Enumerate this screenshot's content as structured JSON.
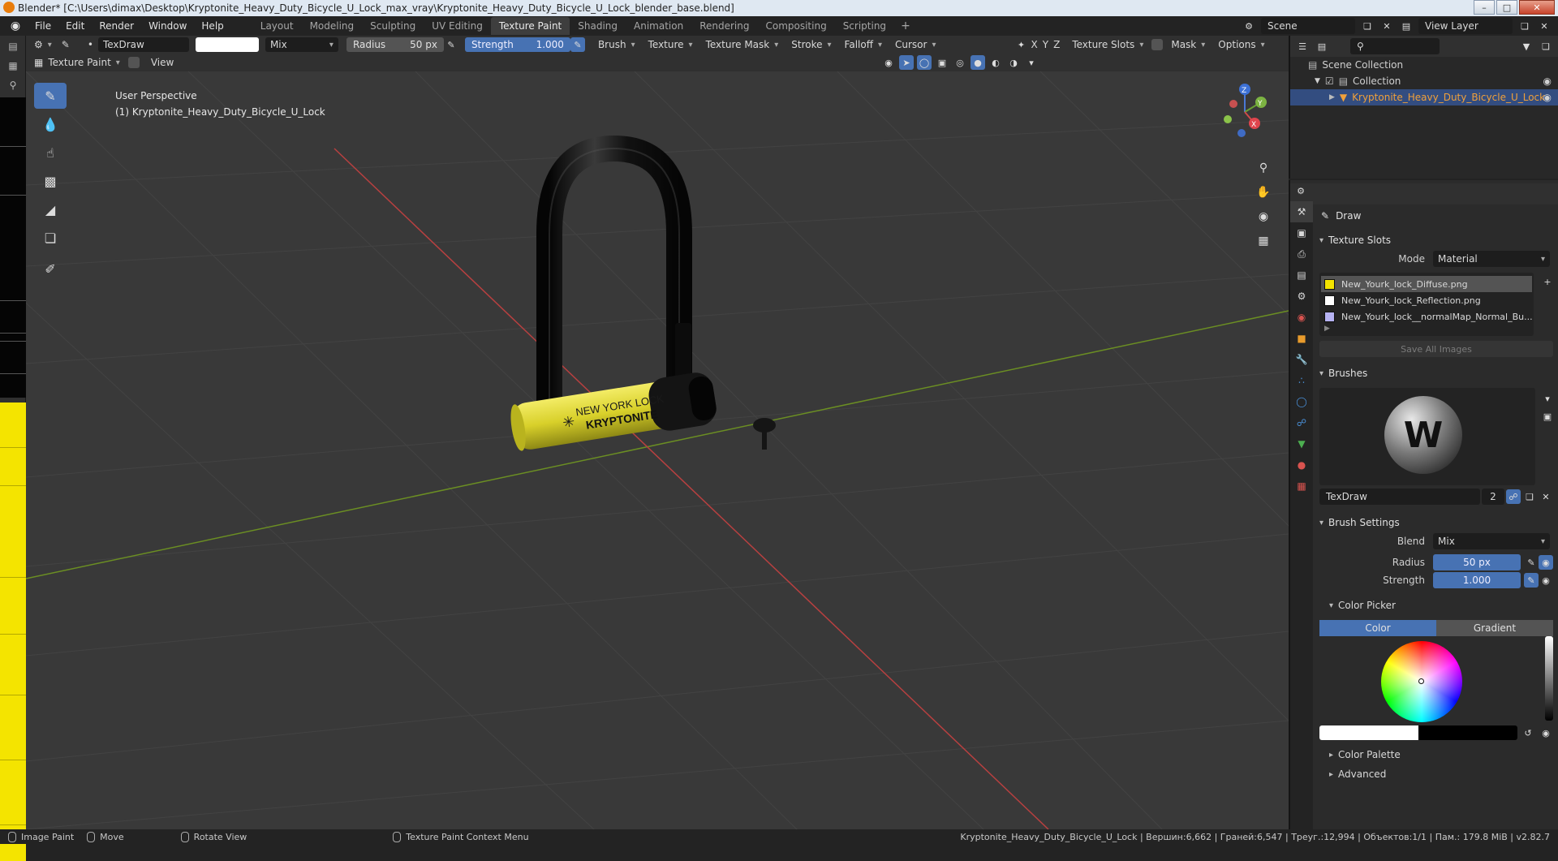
{
  "window": {
    "title": "Blender* [C:\\Users\\dimax\\Desktop\\Kryptonite_Heavy_Duty_Bicycle_U_Lock_max_vray\\Kryptonite_Heavy_Duty_Bicycle_U_Lock_blender_base.blend]"
  },
  "menu": [
    "File",
    "Edit",
    "Render",
    "Window",
    "Help"
  ],
  "workspaces": [
    "Layout",
    "Modeling",
    "Sculpting",
    "UV Editing",
    "Texture Paint",
    "Shading",
    "Animation",
    "Rendering",
    "Compositing",
    "Scripting"
  ],
  "topright": {
    "scene": "Scene",
    "view_layer": "View Layer"
  },
  "tool_header": {
    "brush_name": "TexDraw",
    "blend": "Mix",
    "radius_label": "Radius",
    "radius_value": "50 px",
    "strength_label": "Strength",
    "strength_value": "1.000",
    "menus": [
      "Brush",
      "Texture",
      "Texture Mask",
      "Stroke",
      "Falloff",
      "Cursor"
    ],
    "axes": [
      "X",
      "Y",
      "Z"
    ],
    "texture_slots": "Texture Slots",
    "mask": "Mask",
    "options": "Options",
    "mode": "Texture Paint",
    "view": "View"
  },
  "viewport": {
    "perspective": "User Perspective",
    "object_label": "(1) Kryptonite_Heavy_Duty_Bicycle_U_Lock",
    "gizmo": {
      "z": "Z",
      "y": "Y",
      "x": "X"
    }
  },
  "outliner": {
    "root": "Scene Collection",
    "collection": "Collection",
    "object": "Kryptonite_Heavy_Duty_Bicycle_U_Lock"
  },
  "properties": {
    "tool_name": "Draw",
    "texture_slots": {
      "title": "Texture Slots",
      "mode_label": "Mode",
      "mode_value": "Material",
      "slots": [
        {
          "name": "New_Yourk_lock_Diffuse.png",
          "swatch": "#f4e400"
        },
        {
          "name": "New_Yourk_lock_Reflection.png",
          "swatch": "#ffffff"
        },
        {
          "name": "New_Yourk_lock__normalMap_Normal_Bu...",
          "swatch": "#b6b2f2"
        }
      ],
      "save_all": "Save All Images"
    },
    "brushes": {
      "title": "Brushes",
      "name": "TexDraw",
      "users": "2"
    },
    "brush_settings": {
      "title": "Brush Settings",
      "blend_label": "Blend",
      "blend_value": "Mix",
      "radius_label": "Radius",
      "radius_value": "50 px",
      "strength_label": "Strength",
      "strength_value": "1.000"
    },
    "color_picker": {
      "title": "Color Picker",
      "color_tab": "Color",
      "gradient_tab": "Gradient",
      "color": "#ffffff"
    },
    "color_palette": "Color Palette",
    "advanced": "Advanced"
  },
  "statusbar": {
    "image_paint": "Image Paint",
    "move": "Move",
    "rotate_view": "Rotate View",
    "context_menu": "Texture Paint Context Menu",
    "stats": "Kryptonite_Heavy_Duty_Bicycle_U_Lock | Вершин:6,662 | Граней:6,547 | Треуг.:12,994 | Объектов:1/1 | Пам.: 179.8 MiB | v2.82.7"
  },
  "model_text": {
    "line1": "NEW YORK LOCK",
    "line2": "KRYPTONITE"
  }
}
